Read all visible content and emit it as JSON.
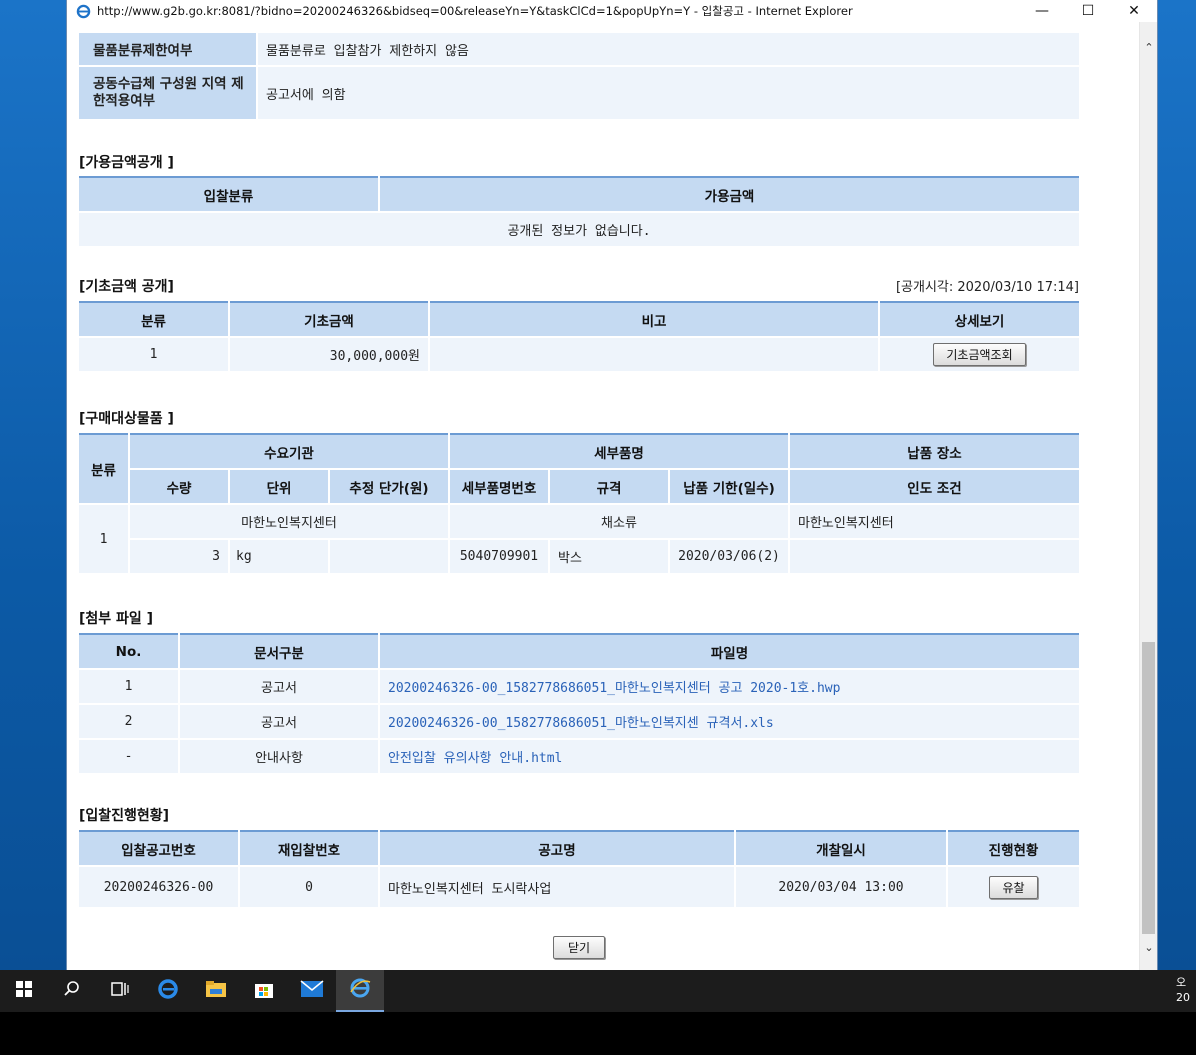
{
  "window": {
    "url": "http://www.g2b.go.kr:8081/?bidno=20200246326&bidseq=00&releaseYn=Y&taskClCd=1&popUpYn=Y",
    "page_title": "입찰공고",
    "app_name": "Internet Explorer",
    "title_sep1": " - ",
    "title_sep2": "  - "
  },
  "restrictions": {
    "rows": [
      {
        "label": "물품분류제한여부",
        "value": "물품분류로 입찰참가 제한하지 않음"
      },
      {
        "label": "공동수급체 구성원 지역 제한적용여부",
        "value": "공고서에 의함"
      }
    ]
  },
  "available_amount": {
    "title": "[가용금액공개 ]",
    "headers": [
      "입찰분류",
      "가용금액"
    ],
    "empty_message": "공개된 정보가 없습니다."
  },
  "base_amount": {
    "title": "[기초금액 공개]",
    "open_time": "[공개시각: 2020/03/10 17:14]",
    "headers": [
      "분류",
      "기초금액",
      "비고",
      "상세보기"
    ],
    "row": {
      "category": "1",
      "amount": "30,000,000원",
      "note": "",
      "button": "기초금액조회"
    }
  },
  "purchase_items": {
    "title": "[구매대상물품 ]",
    "header_row1": {
      "category": "분류",
      "agency": "수요기관",
      "item_name": "세부품명",
      "delivery_place": "납품 장소"
    },
    "header_row2": [
      "수량",
      "단위",
      "추정 단가(원)",
      "세부품명번호",
      "규격",
      "납품 기한(일수)",
      "인도 조건"
    ],
    "row": {
      "category": "1",
      "agency": "마한노인복지센터",
      "item_name": "채소류",
      "delivery_place": "마한노인복지센터",
      "quantity": "3",
      "unit": "kg",
      "unit_price": "",
      "item_no": "5040709901",
      "spec": "박스",
      "deadline": "2020/03/06(2)",
      "delivery_terms": ""
    }
  },
  "attachments": {
    "title": "[첨부 파일 ]",
    "headers": [
      "No.",
      "문서구분",
      "파일명"
    ],
    "rows": [
      {
        "no": "1",
        "type": "공고서",
        "file": "20200246326-00_1582778686051_마한노인복지센터 공고 2020-1호.hwp"
      },
      {
        "no": "2",
        "type": "공고서",
        "file": "20200246326-00_1582778686051_마한노인복지센 규격서.xls"
      },
      {
        "no": "-",
        "type": "안내사항",
        "file": "안전입찰 유의사항 안내.html"
      }
    ]
  },
  "bid_progress": {
    "title": "[입찰진행현황]",
    "headers": [
      "입찰공고번호",
      "재입찰번호",
      "공고명",
      "개찰일시",
      "진행현황"
    ],
    "row": {
      "bid_no": "20200246326-00",
      "rebid_no": "0",
      "name": "마한노인복지센터 도시락사업",
      "open_date": "2020/03/04 13:00",
      "status": "유찰"
    }
  },
  "close_button": "닫기",
  "tray": {
    "line1": "오",
    "line2": "20"
  }
}
